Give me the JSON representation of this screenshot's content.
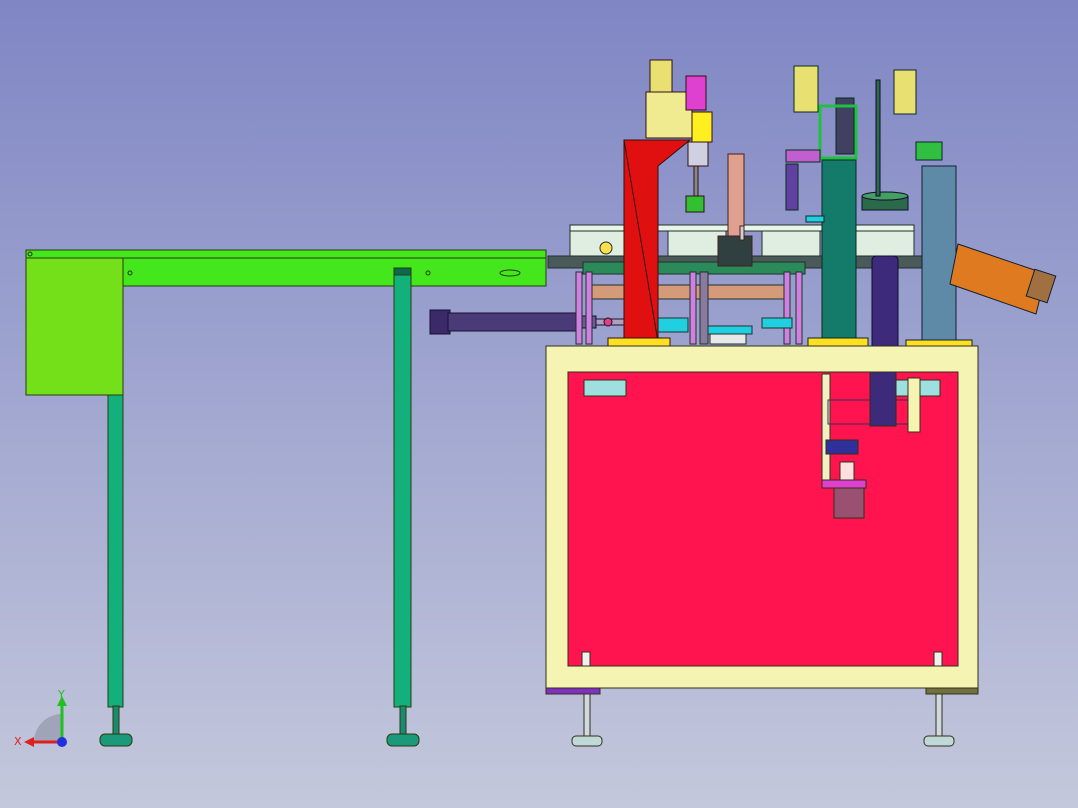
{
  "viewport": {
    "background_top": "#7f86c4",
    "background_bottom": "#c4c8dc"
  },
  "triad": {
    "x_label": "X",
    "y_label": "Y",
    "x_color": "#e02020",
    "y_color": "#20c020",
    "z_color": "#2030e0"
  },
  "colors": {
    "cabinet_frame": "#f6f4b2",
    "cabinet_panel": "#ff1450",
    "conveyor": "#44e61c",
    "conveyor_box": "#74e01a",
    "leg": "#12b07a",
    "red_column": "#e01010",
    "teal_column": "#147a6a",
    "blue_column": "#5e8aa8",
    "cylinder": "#3a2a6a",
    "chute": "#e07a20"
  }
}
